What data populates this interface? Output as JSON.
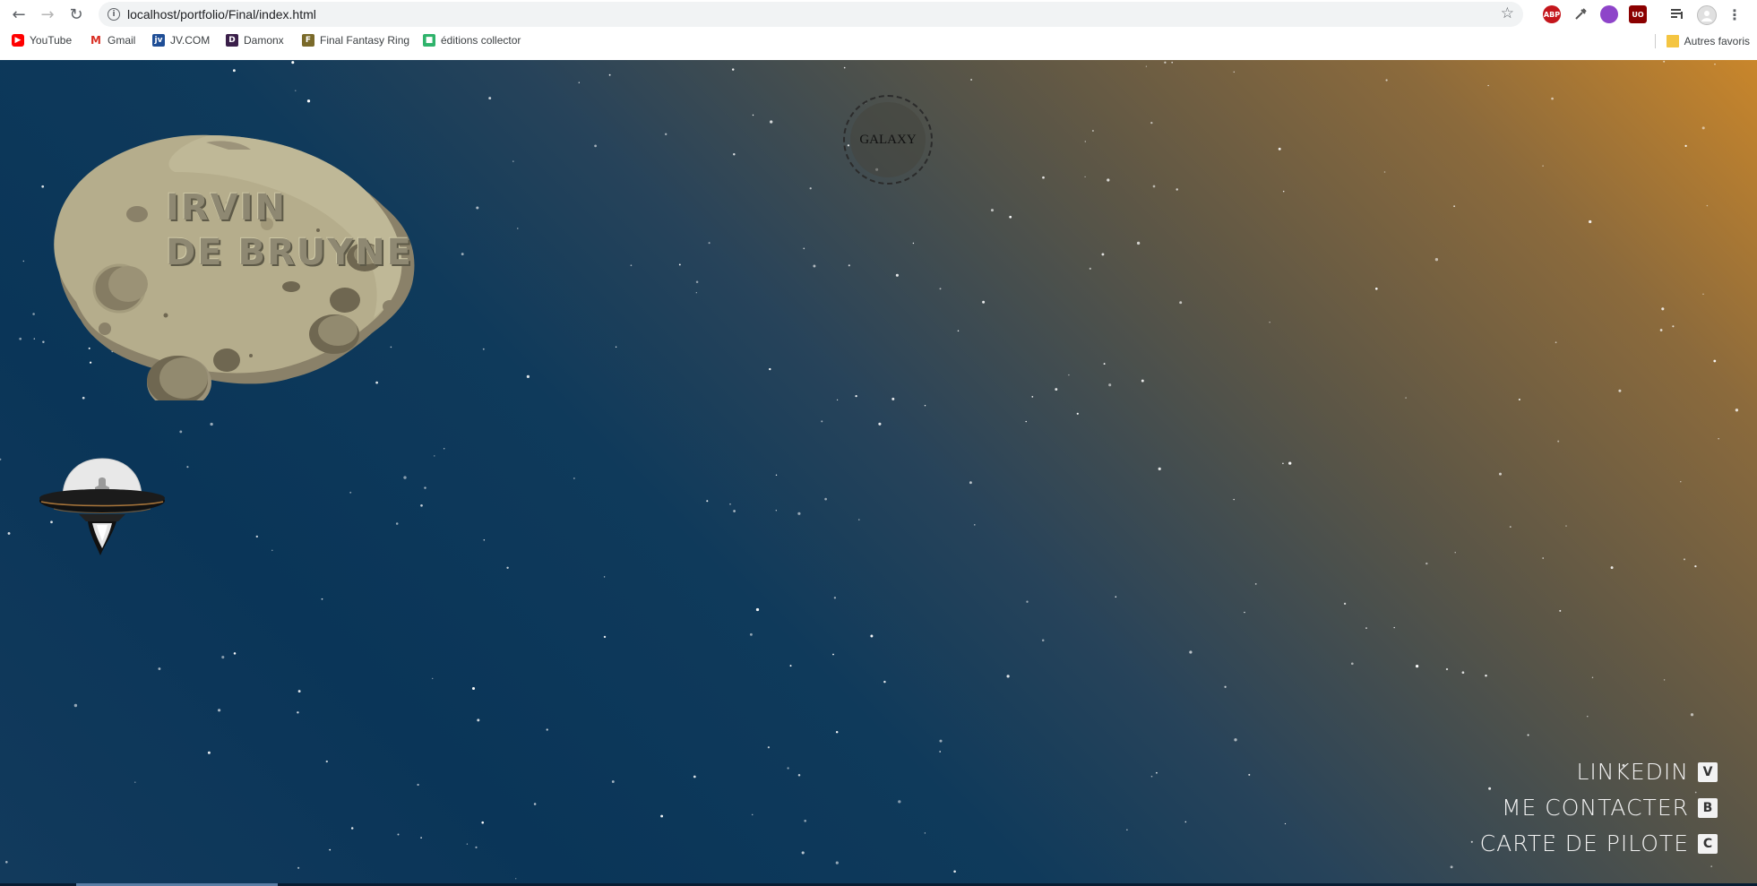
{
  "browser": {
    "url": "localhost/portfolio/Final/index.html",
    "nav": {
      "back_icon": "arrow-left-icon",
      "forward_icon": "arrow-right-icon",
      "reload_icon": "reload-icon"
    },
    "extensions": [
      {
        "name": "adblock-icon",
        "label": "ABP",
        "color": "#c4161c"
      },
      {
        "name": "eyedropper-icon",
        "label": "",
        "color": "#555555"
      },
      {
        "name": "puzzle-icon",
        "label": "",
        "color": "#8e44c9"
      },
      {
        "name": "ublock-icon",
        "label": "UO",
        "color": "#8b0000"
      },
      {
        "name": "media-icon",
        "label": "",
        "color": "#444444"
      },
      {
        "name": "profile-icon",
        "label": "",
        "color": "#bdbdbd"
      },
      {
        "name": "menu-icon",
        "label": "",
        "color": "#5f6368"
      }
    ],
    "bookmarks": [
      {
        "label": "YouTube",
        "icon": "youtube-icon",
        "color": "#ff0000"
      },
      {
        "label": "Gmail",
        "icon": "gmail-icon",
        "color": "#d93025"
      },
      {
        "label": "JV.COM",
        "icon": "jvcom-icon",
        "color": "#1f4e96"
      },
      {
        "label": "Damonx",
        "icon": "damonx-icon",
        "color": "#3a1f4a"
      },
      {
        "label": "Final Fantasy Ring",
        "icon": "ffring-icon",
        "color": "#7a6a2a"
      },
      {
        "label": "éditions collector",
        "icon": "collector-icon",
        "color": "#2fb36b"
      }
    ],
    "other_bookmarks": "Autres favoris"
  },
  "page": {
    "galaxy_label": "GALAXY",
    "title_line1": "IRVIN",
    "title_line2": "DE BRUYNE",
    "menu": [
      {
        "label": "LINKEDIN",
        "key": "V"
      },
      {
        "label": "ME CONTACTER",
        "key": "B"
      },
      {
        "label": "CARTE DE PILOTE",
        "key": "C"
      }
    ],
    "colors": {
      "sky_top_right": "#c9862b",
      "sky_bottom_left": "#0a3558",
      "rock": "#aba386"
    }
  }
}
